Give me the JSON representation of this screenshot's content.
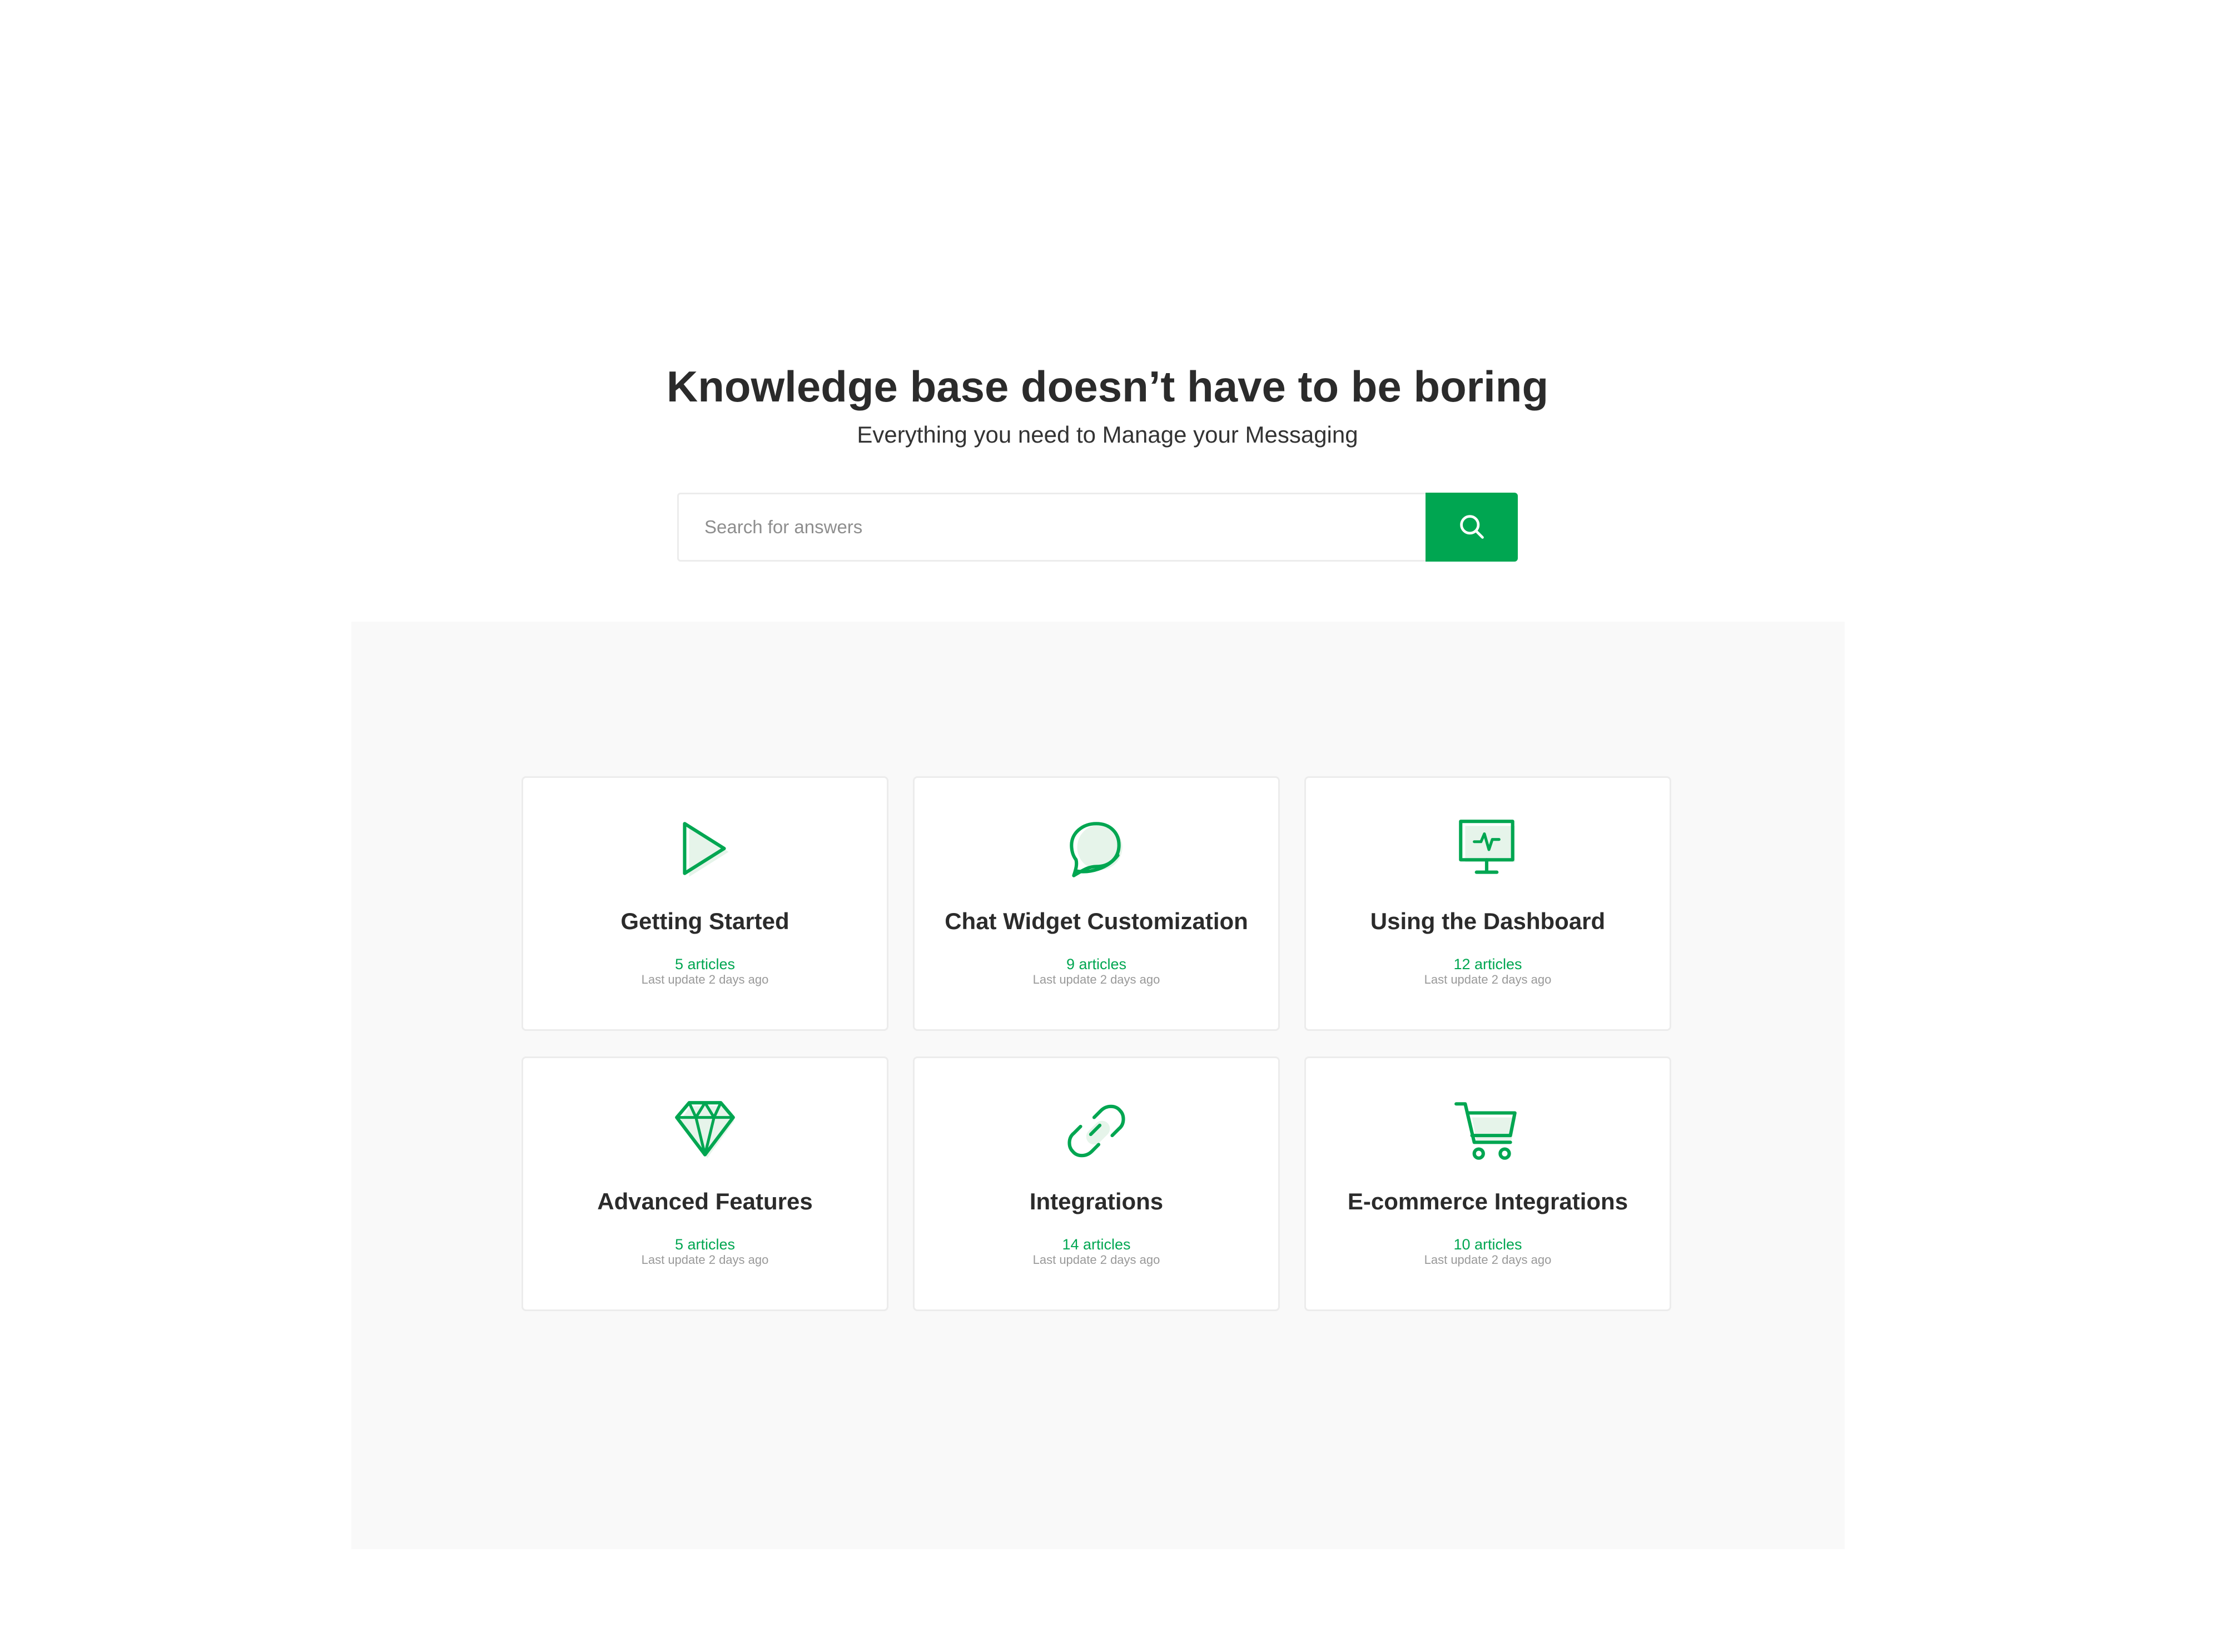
{
  "hero": {
    "title": "Knowledge base doesn’t have to be boring",
    "subtitle": "Everything you need to Manage your Messaging"
  },
  "search": {
    "placeholder": "Search for answers",
    "value": "",
    "button_icon": "search-icon"
  },
  "categories": [
    {
      "title": "Getting Started",
      "articles": "5 articles",
      "updated": "Last update 2 days ago",
      "icon": "play-icon"
    },
    {
      "title": "Chat Widget Customization",
      "articles": "9 articles",
      "updated": "Last update 2 days ago",
      "icon": "chat-bubble-icon"
    },
    {
      "title": "Using the Dashboard",
      "articles": "12 articles",
      "updated": "Last update 2 days ago",
      "icon": "monitor-icon"
    },
    {
      "title": "Advanced Features",
      "articles": "5 articles",
      "updated": "Last update 2 days ago",
      "icon": "diamond-icon"
    },
    {
      "title": "Integrations",
      "articles": "14 articles",
      "updated": "Last update 2 days ago",
      "icon": "link-icon"
    },
    {
      "title": "E-commerce Integrations",
      "articles": "10 articles",
      "updated": "Last update 2 days ago",
      "icon": "shopping-cart-icon"
    }
  ],
  "colors": {
    "accent": "#00a651",
    "icon_fill": "#e6f4ea",
    "panel_background": "#f9f9f9",
    "card_border": "#ececec",
    "title_text": "#2b2b2b",
    "muted_text": "#999999"
  }
}
